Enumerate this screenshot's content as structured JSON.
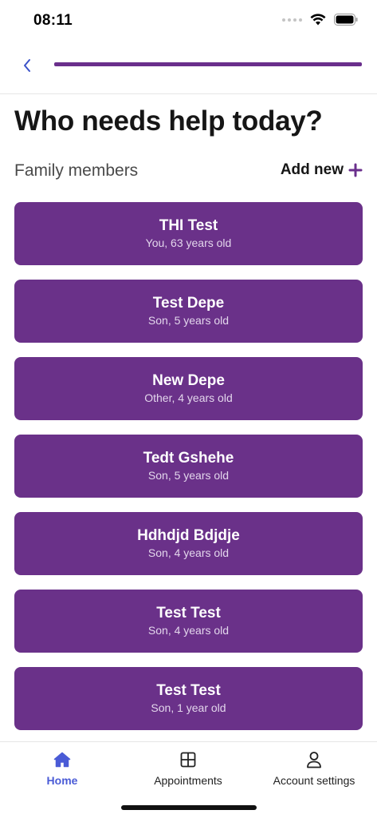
{
  "status_bar": {
    "time": "08:11"
  },
  "nav": {
    "progress_fraction": 1.0,
    "accent_color": "#6a2f8c"
  },
  "page": {
    "title": "Who needs help today?"
  },
  "family": {
    "section_label": "Family members",
    "add_new_label": "Add new",
    "members": [
      {
        "name": "THI Test",
        "description": "You, 63 years old"
      },
      {
        "name": "Test Depe",
        "description": "Son, 5 years old"
      },
      {
        "name": "New Depe",
        "description": "Other, 4 years old"
      },
      {
        "name": "Tedt Gshehe",
        "description": "Son, 5 years old"
      },
      {
        "name": "Hdhdjd Bdjdje",
        "description": "Son, 4 years old"
      },
      {
        "name": "Test Test",
        "description": "Son, 4 years old"
      },
      {
        "name": "Test Test",
        "description": "Son, 1 year old"
      }
    ],
    "card_color": "#6a3189"
  },
  "tab_bar": {
    "tabs": [
      {
        "label": "Home",
        "icon": "home-icon",
        "active": true
      },
      {
        "label": "Appointments",
        "icon": "grid-icon",
        "active": false
      },
      {
        "label": "Account settings",
        "icon": "user-icon",
        "active": false
      }
    ],
    "active_color": "#4a5bd6"
  }
}
